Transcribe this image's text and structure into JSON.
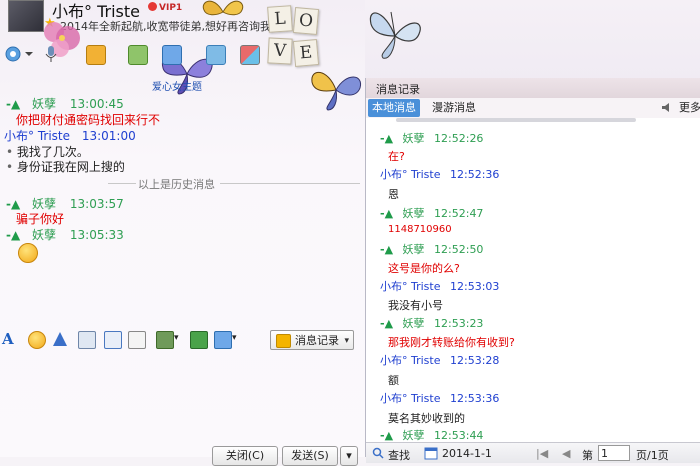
{
  "header": {
    "nickname": "小布° Triste",
    "vip_label": "VIP1",
    "signature": "2014年全新起航,收宽带徒弟,想好再咨询我哦",
    "love_letters": [
      "L",
      "O",
      "V",
      "E"
    ]
  },
  "toolbar": {
    "qq_show_link": "爱心女主题"
  },
  "chat": {
    "messages": [
      {
        "name": "妖孽",
        "time": "13:00:45",
        "text": "你把财付通密码找回来行不"
      },
      {
        "name": "小布° Triste",
        "time": "13:01:00",
        "lines": [
          "我找了几次。",
          "身份证我在网上搜的"
        ]
      },
      {
        "name": "妖孽",
        "time": "13:03:57",
        "text": "骗子你好"
      },
      {
        "name": "妖孽",
        "time": "13:05:33",
        "text": ""
      }
    ],
    "history_divider": "以上是历史消息"
  },
  "input_toolbar": {
    "message_record_label": "消息记录"
  },
  "bottom": {
    "close_label": "关闭(C)",
    "send_label": "发送(S)"
  },
  "history_panel": {
    "title": "消息记录",
    "tab_local": "本地消息",
    "tab_roaming": "漫游消息",
    "more_label": "更多",
    "entries": [
      {
        "name": "妖孽",
        "time": "12:52:26",
        "text": "在?",
        "kind": "red"
      },
      {
        "name": "小布° Triste",
        "time": "12:52:36",
        "text": "恩",
        "kind": "dark"
      },
      {
        "name": "妖孽",
        "time": "12:52:47",
        "text": "1148710960",
        "kind": "red"
      },
      {
        "name": "妖孽",
        "time": "12:52:50",
        "text": "这号是你的么?",
        "kind": "red"
      },
      {
        "name": "小布° Triste",
        "time": "12:53:03",
        "text": "我没有小号",
        "kind": "dark"
      },
      {
        "name": "妖孽",
        "time": "12:53:23",
        "text": "那我刚才转账给你有收到?",
        "kind": "red"
      },
      {
        "name": "小布° Triste",
        "time": "12:53:28",
        "text": "额",
        "kind": "dark"
      },
      {
        "name": "小布° Triste",
        "time": "12:53:36",
        "text": "莫名其妙收到的",
        "kind": "dark"
      },
      {
        "name": "妖孽",
        "time": "12:53:44",
        "text": "",
        "kind": "dark"
      }
    ],
    "footer": {
      "search_label": "查找",
      "date": "2014-1-1",
      "page_prefix": "第",
      "page_value": "1",
      "page_suffix": "页/1页"
    }
  },
  "colors": {
    "green_name": "#2e9e52",
    "blue_name": "#1f3fd0",
    "red_text": "#e00000",
    "tab_active": "#4a90d9"
  }
}
